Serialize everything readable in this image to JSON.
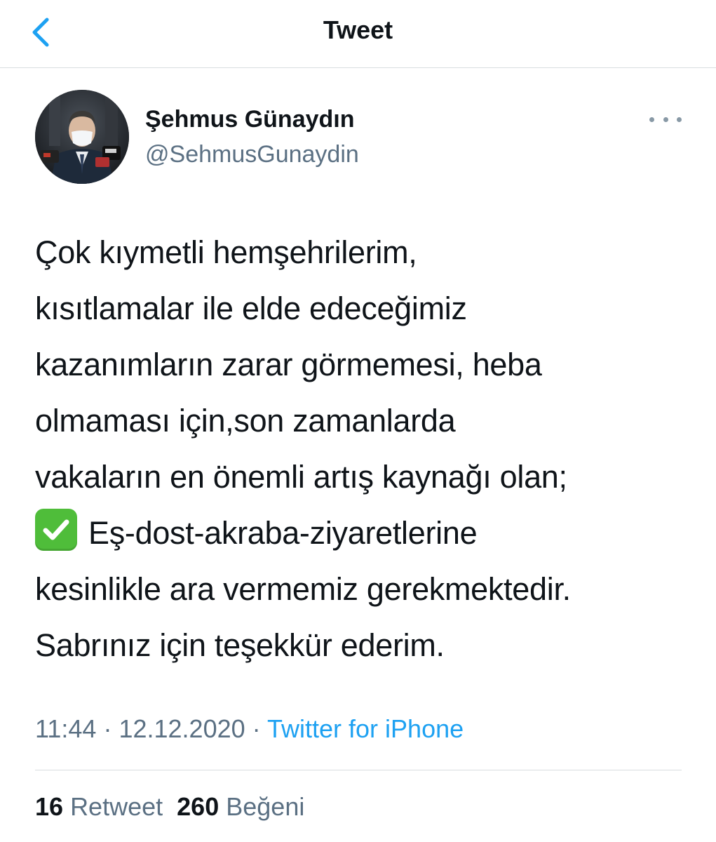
{
  "header": {
    "title": "Tweet",
    "back_icon": "chevron-left-icon",
    "accent_color": "#1da1f2"
  },
  "author": {
    "name": "Şehmus Günaydın",
    "handle": "@SehmusGunaydin",
    "avatar": "profile-photo"
  },
  "tweet": {
    "lines": [
      "Çok kıymetli hemşehrilerim,",
      "kısıtlamalar ile elde edeceğimiz",
      "kazanımların zarar görmemesi, heba",
      "olmaması için,son zamanlarda",
      "vakaların en önemli artış kaynağı olan;",
      "Eş-dost-akraba-ziyaretlerine",
      "kesinlikle ara vermemiz gerekmektedir.",
      "Sabrınız için teşekkür ederim."
    ],
    "emoji": "check-mark-button-emoji"
  },
  "meta": {
    "time": "11:44",
    "date": "12.12.2020",
    "separator": "·",
    "source": "Twitter for iPhone"
  },
  "stats": {
    "retweets": "16",
    "retweet_label": "Retweet",
    "likes": "260",
    "like_label": "Beğeni"
  }
}
